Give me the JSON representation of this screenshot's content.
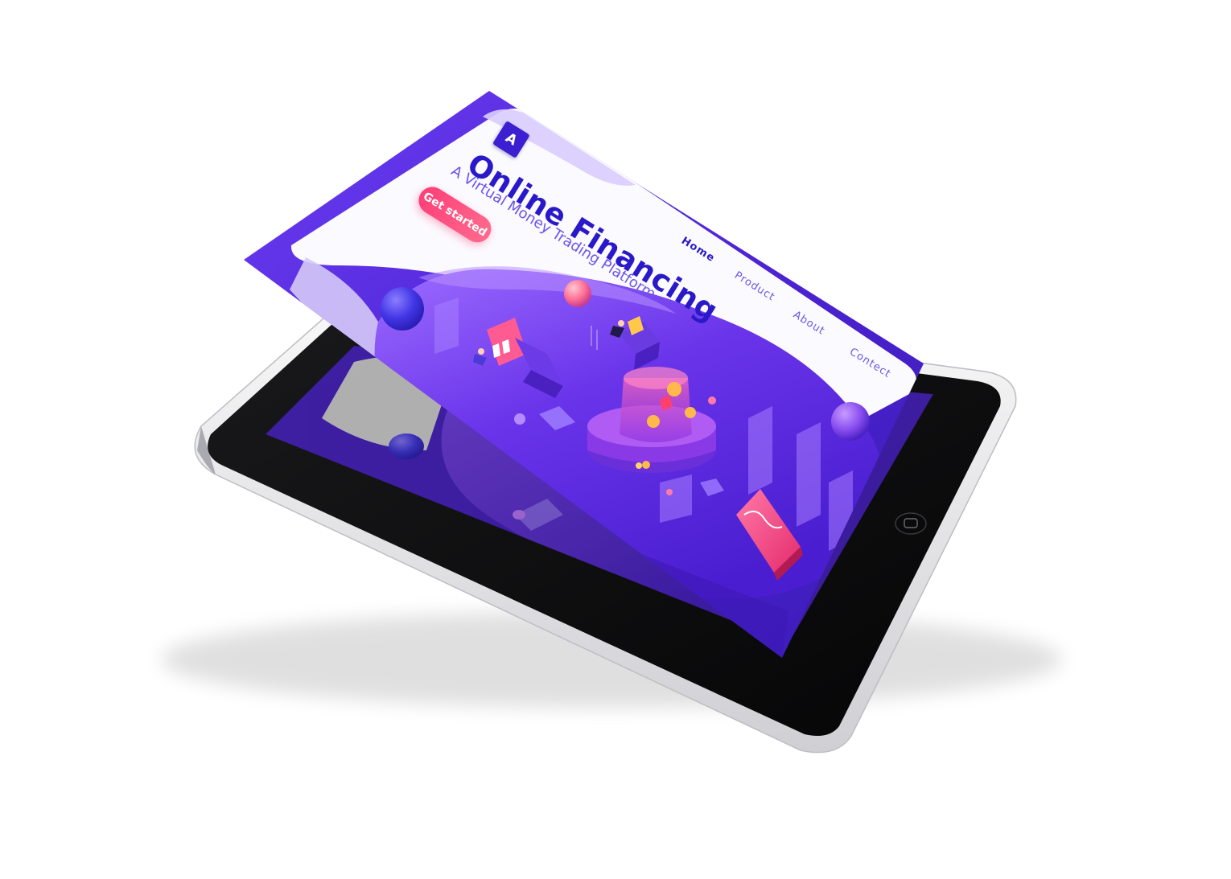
{
  "site": {
    "logo_letter": "A",
    "title": "Online Financing",
    "subtitle": "A Virtual Money Trading Platform",
    "cta_label": "Get started"
  },
  "nav": {
    "items": [
      {
        "label": "Home",
        "active": true
      },
      {
        "label": "Product",
        "active": false
      },
      {
        "label": "About",
        "active": false
      },
      {
        "label": "Contect",
        "active": false
      }
    ]
  },
  "colors": {
    "brand_blue": "#2a19c9",
    "accent_pink": "#ff4f7f",
    "purple_dark": "#5326d6",
    "purple_light": "#8a5cf5",
    "device_frame": "#f2f2f4",
    "device_screen": "#0b0b0d"
  },
  "icons": {
    "home_button": "home-button-icon",
    "logo": "logo-icon"
  }
}
